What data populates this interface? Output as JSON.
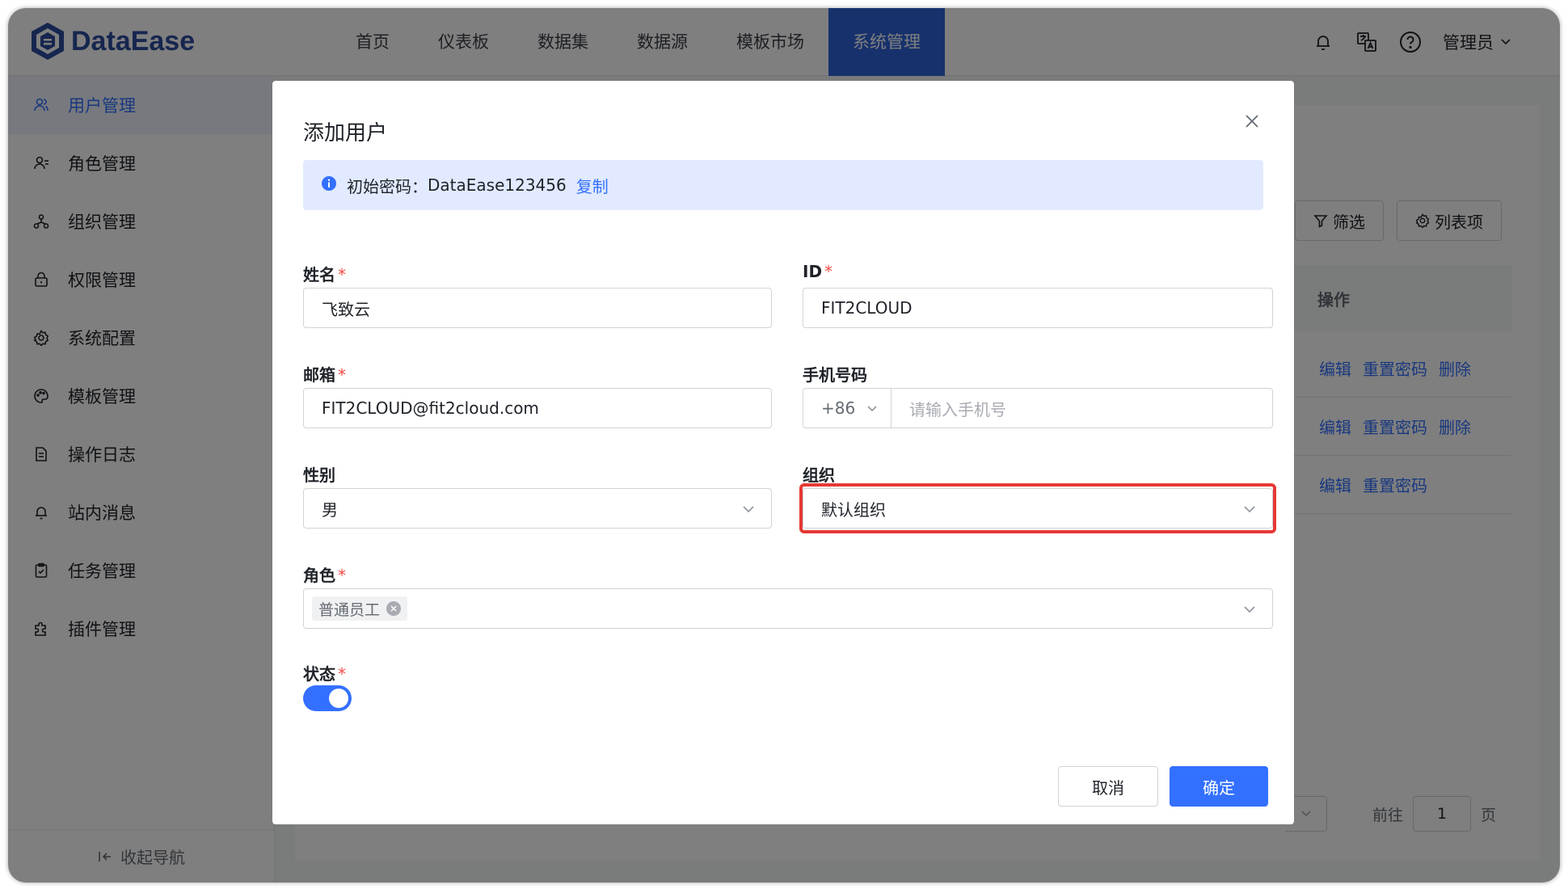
{
  "app": {
    "logo_text": "DataEase",
    "brand_color": "#2f62d8",
    "accent_color": "#3370ff"
  },
  "nav": {
    "items": [
      {
        "label": "首页"
      },
      {
        "label": "仪表板"
      },
      {
        "label": "数据集"
      },
      {
        "label": "数据源"
      },
      {
        "label": "模板市场"
      },
      {
        "label": "系统管理",
        "active": true
      }
    ]
  },
  "header_icons": [
    "bell-icon",
    "translate-icon",
    "help-icon"
  ],
  "user": {
    "name": "管理员"
  },
  "sidebar": {
    "items": [
      {
        "label": "用户管理",
        "icon": "users-icon",
        "active": true
      },
      {
        "label": "角色管理",
        "icon": "role-icon"
      },
      {
        "label": "组织管理",
        "icon": "org-icon"
      },
      {
        "label": "权限管理",
        "icon": "lock-icon"
      },
      {
        "label": "系统配置",
        "icon": "gear-icon"
      },
      {
        "label": "模板管理",
        "icon": "palette-icon"
      },
      {
        "label": "操作日志",
        "icon": "log-icon"
      },
      {
        "label": "站内消息",
        "icon": "bell-icon"
      },
      {
        "label": "任务管理",
        "icon": "task-icon"
      },
      {
        "label": "插件管理",
        "icon": "plugin-icon"
      }
    ],
    "collapse_label": "收起导航"
  },
  "background": {
    "filter_label": "筛选",
    "columns_label": "列表项",
    "action_header": "操作",
    "rows": [
      [
        "编辑",
        "重置密码",
        "删除"
      ],
      [
        "编辑",
        "重置密码",
        "删除"
      ],
      [
        "编辑",
        "重置密码"
      ]
    ],
    "pager": {
      "goto_label": "前往",
      "page": "1",
      "page_suffix": "页"
    }
  },
  "dialog": {
    "title": "添加用户",
    "alert": {
      "label": "初始密码：",
      "password": "DataEase123456",
      "copy_label": "复制"
    },
    "fields": {
      "name": {
        "label": "姓名",
        "value": "飞致云"
      },
      "id": {
        "label": "ID",
        "value": "FIT2CLOUD"
      },
      "email": {
        "label": "邮箱",
        "value": "FIT2CLOUD@fit2cloud.com"
      },
      "phone": {
        "label": "手机号码",
        "prefix": "+86",
        "placeholder": "请输入手机号"
      },
      "gender": {
        "label": "性别",
        "value": "男"
      },
      "org": {
        "label": "组织",
        "value": "默认组织"
      },
      "role": {
        "label": "角色",
        "tags": [
          "普通员工"
        ]
      },
      "status": {
        "label": "状态",
        "enabled": true
      }
    },
    "required_mark": "*",
    "cancel_label": "取消",
    "ok_label": "确定"
  }
}
